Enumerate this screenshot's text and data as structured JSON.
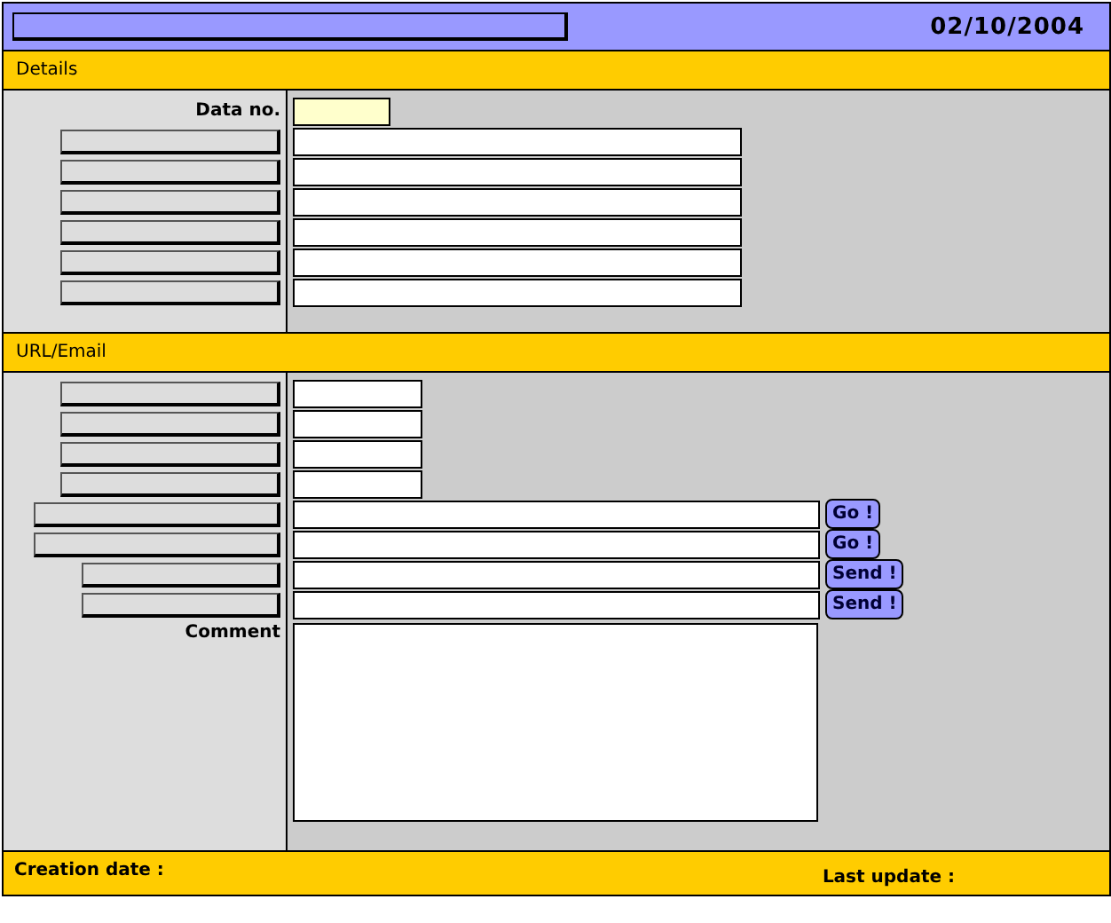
{
  "header": {
    "date": "02/10/2004"
  },
  "sections": [
    {
      "title": "Details",
      "rows": [
        {
          "kind": "named",
          "label": "Data no.",
          "input": {
            "kind": "code"
          }
        },
        {
          "kind": "blank",
          "input": {
            "kind": "wide"
          }
        },
        {
          "kind": "blank",
          "input": {
            "kind": "wide"
          }
        },
        {
          "kind": "blank",
          "input": {
            "kind": "wide"
          }
        },
        {
          "kind": "blank",
          "input": {
            "kind": "wide"
          }
        },
        {
          "kind": "blank",
          "input": {
            "kind": "wide"
          }
        },
        {
          "kind": "blank",
          "input": {
            "kind": "wide"
          }
        }
      ]
    },
    {
      "title": "URL/Email",
      "rows": [
        {
          "kind": "blank",
          "input": {
            "kind": "short"
          }
        },
        {
          "kind": "blank",
          "input": {
            "kind": "short"
          }
        },
        {
          "kind": "blank",
          "input": {
            "kind": "short"
          }
        },
        {
          "kind": "blank",
          "input": {
            "kind": "short"
          }
        },
        {
          "kind": "blank-long",
          "input": {
            "kind": "link"
          },
          "action": "Go !"
        },
        {
          "kind": "blank-long",
          "input": {
            "kind": "link"
          },
          "action": "Go !"
        },
        {
          "kind": "blank-narrow",
          "input": {
            "kind": "link"
          },
          "action": "Send !"
        },
        {
          "kind": "blank-narrow",
          "input": {
            "kind": "link"
          },
          "action": "Send !"
        },
        {
          "kind": "named",
          "label": "Comment",
          "input": {
            "kind": "memo"
          }
        }
      ]
    }
  ],
  "footer": {
    "created": "Creation date :",
    "updated": "Last update :"
  }
}
